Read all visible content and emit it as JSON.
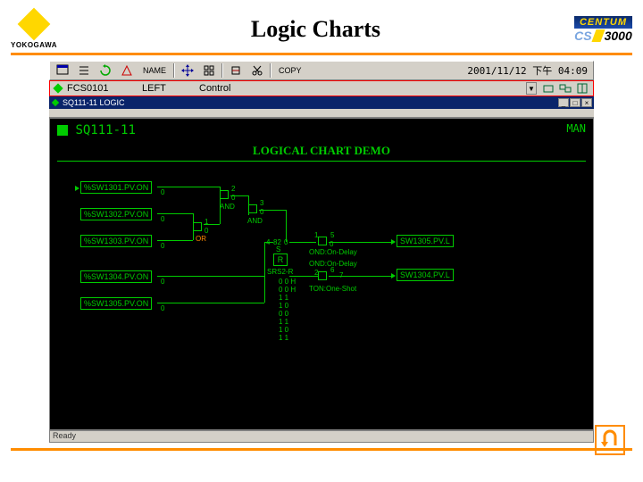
{
  "slide": {
    "brand": "YOKOGAWA",
    "title": "Logic Charts",
    "product_top": "CENTUM",
    "product_cs": "CS",
    "product_num": "3000"
  },
  "toolbar": {
    "clock": "2001/11/12 下午 04:09",
    "copy": "COPY",
    "name": "NAME"
  },
  "path": {
    "fcs": "FCS0101",
    "left": "LEFT",
    "control": "Control"
  },
  "window": {
    "title": "SQ111-11 LOGIC"
  },
  "chart": {
    "block_id": "SQ111-11",
    "mode": "MAN",
    "title": "LOGICAL CHART DEMO"
  },
  "inputs": [
    {
      "label": "%SW1301.PV.ON",
      "val": "0"
    },
    {
      "label": "%SW1302.PV.ON",
      "val": "0"
    },
    {
      "label": "%SW1303.PV.ON",
      "val": "0"
    },
    {
      "label": "%SW1304.PV.ON",
      "val": "0"
    },
    {
      "label": "%SW1305.PV.ON",
      "val": "0"
    }
  ],
  "outputs": [
    {
      "label": "SW1305.PV.L"
    },
    {
      "label": "SW1304.PV.L"
    }
  ],
  "gates": {
    "and1": "AND",
    "and2": "AND",
    "or": "OR",
    "srs": "SRS2-R",
    "ond1": "OND:On-Delay",
    "ond2": "OND:On-Delay",
    "ton": "TON:One-Shot",
    "r": "R"
  },
  "pins": {
    "p0": "0",
    "p1": "1",
    "p2": "2",
    "p3": "3",
    "p4": "4",
    "p5": "5",
    "p6": "6",
    "p7": "7",
    "p82": "82",
    "h": "H",
    "s": "S"
  },
  "truth": "0 0 H\n0 0 H\n1 1\n1 0\n0 0\n1 1\n1 0\n1 1",
  "status": "Ready"
}
